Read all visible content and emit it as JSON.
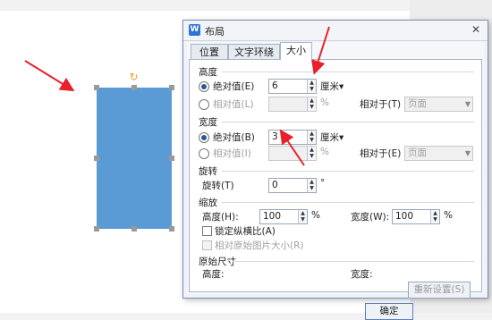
{
  "dialog": {
    "title": "布局",
    "tabs": [
      "位置",
      "文字环绕",
      "大小"
    ],
    "height_section": {
      "label": "高度",
      "absolute_label": "绝对值(E)",
      "absolute_value": "6",
      "unit": "厘米▾",
      "relative_label": "相对值(L)",
      "relative_unit": "%",
      "relative_to_label": "相对于(T)",
      "relative_to_value": "页面"
    },
    "width_section": {
      "label": "宽度",
      "absolute_label": "绝对值(B)",
      "absolute_value": "3",
      "unit": "厘米▾",
      "relative_label": "相对值(I)",
      "relative_unit": "%",
      "relative_to_label": "相对于(E)",
      "relative_to_value": "页面"
    },
    "rotate_section": {
      "label": "旋转",
      "rotate_label": "旋转(T)",
      "rotate_value": "0",
      "unit": "°"
    },
    "scale_section": {
      "label": "缩放",
      "height_label": "高度(H):",
      "height_value": "100",
      "width_label": "宽度(W):",
      "width_value": "100",
      "unit": "%",
      "lock_ratio_label": "锁定纵横比(A)",
      "relative_original_label": "相对原始图片大小(R)"
    },
    "original_size_section": {
      "label": "原始尺寸",
      "height_label": "高度:",
      "width_label": "宽度:",
      "reset_label": "重新设置(S)"
    },
    "ok_label": "确定"
  },
  "icons": {
    "app": "wps-icon",
    "close": "close-icon",
    "rotate": "rotate-handle-icon"
  },
  "colors": {
    "shape": "#5b9bd5",
    "arrow": "#e8202a",
    "accent": "#2e75d6"
  }
}
